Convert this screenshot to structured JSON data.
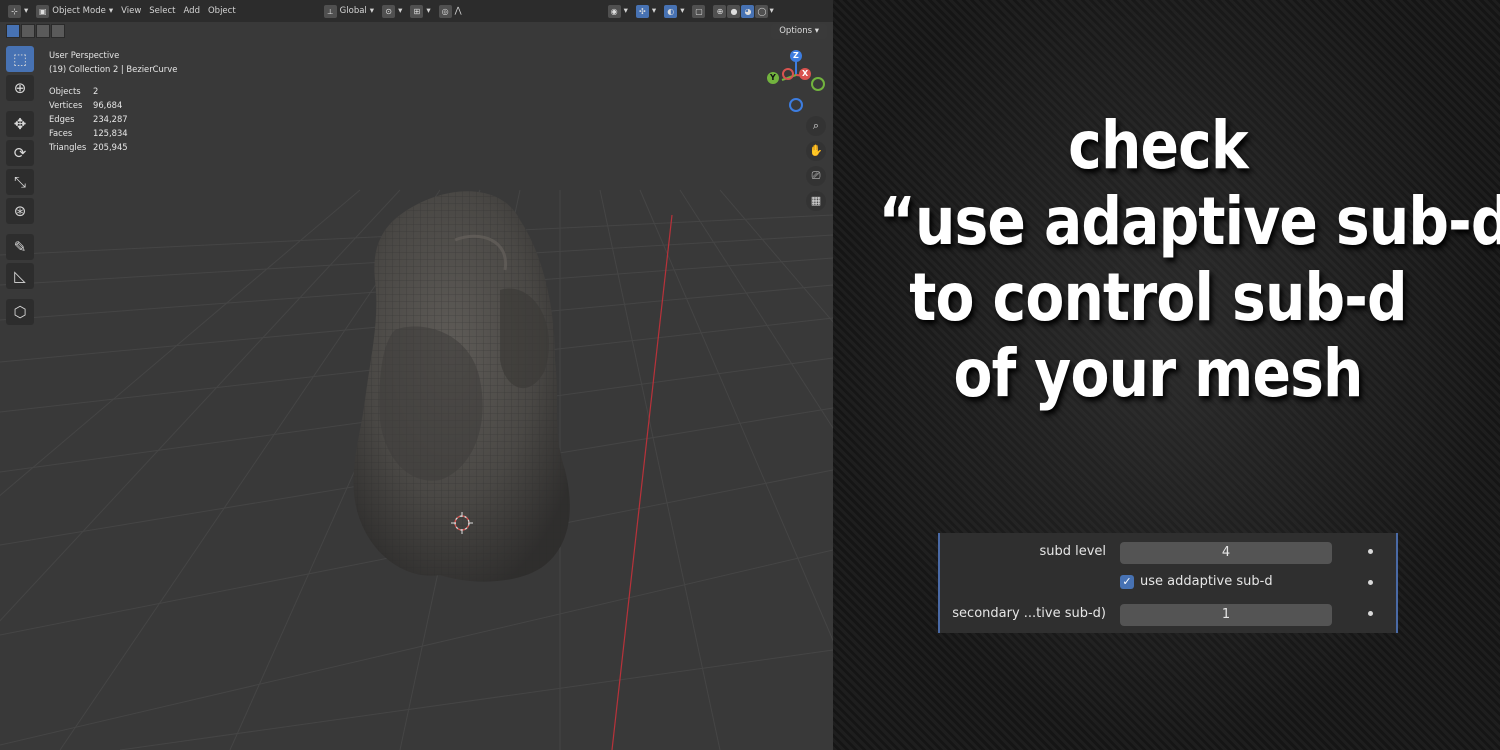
{
  "header": {
    "mode": "Object Mode",
    "menus": [
      "View",
      "Select",
      "Add",
      "Object"
    ],
    "transform_orientation": "Global",
    "options": "Options"
  },
  "overlay": {
    "view_name": "User Perspective",
    "collection": "(19) Collection 2 | BezierCurve",
    "stats": [
      {
        "label": "Objects",
        "value": "2"
      },
      {
        "label": "Vertices",
        "value": "96,684"
      },
      {
        "label": "Edges",
        "value": "234,287"
      },
      {
        "label": "Faces",
        "value": "125,834"
      },
      {
        "label": "Triangles",
        "value": "205,945"
      }
    ]
  },
  "gizmo": {
    "z": "Z",
    "y": "Y",
    "x": "X"
  },
  "caption": {
    "line1": "check",
    "line2": "“use adaptive sub-d”",
    "line3": "to control sub-d",
    "line4": "of your mesh"
  },
  "panel": {
    "subd_label": "subd level",
    "subd_value": "4",
    "adaptive_label": "use addaptive sub-d",
    "adaptive_checked": true,
    "secondary_label": "secondary ...tive sub-d)",
    "secondary_value": "1"
  },
  "colors": {
    "accent": "#4772b3",
    "viewport_bg": "#393939",
    "x_axis": "#d9534f",
    "y_axis": "#72b33e",
    "z_axis": "#3d7de0"
  }
}
